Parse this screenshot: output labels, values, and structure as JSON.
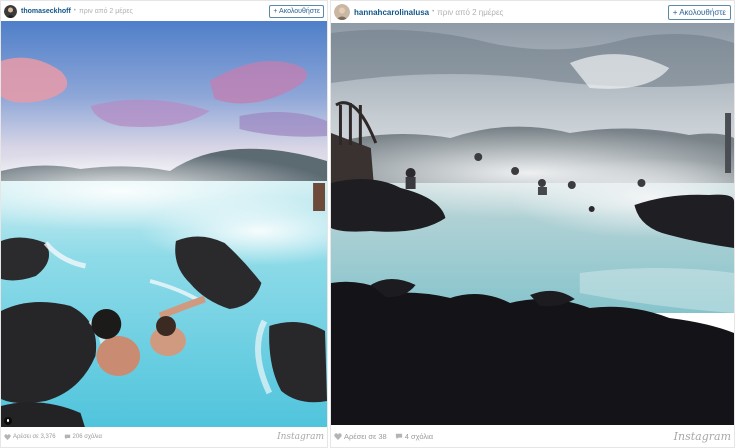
{
  "posts": [
    {
      "username": "thomaseckhoff",
      "time": "πριν από 2 μέρες",
      "follow_label": "+ Ακολουθήστε",
      "likes": "Αρέσει σε 3,376",
      "comments": "206 σχόλια",
      "brand": "Instagram",
      "photo_icon": "person-tag-icon"
    },
    {
      "username": "hannahcarolinalusa",
      "time": "πριν από 2 ημέρες",
      "follow_label": "+ Ακολουθήστε",
      "likes": "Αρέσει σε 38",
      "comments": "4 σχόλια",
      "brand": "Instagram"
    }
  ],
  "colors": {
    "username": "#125688",
    "follow_border": "#5d89a8",
    "muted": "#9a9a9a"
  }
}
